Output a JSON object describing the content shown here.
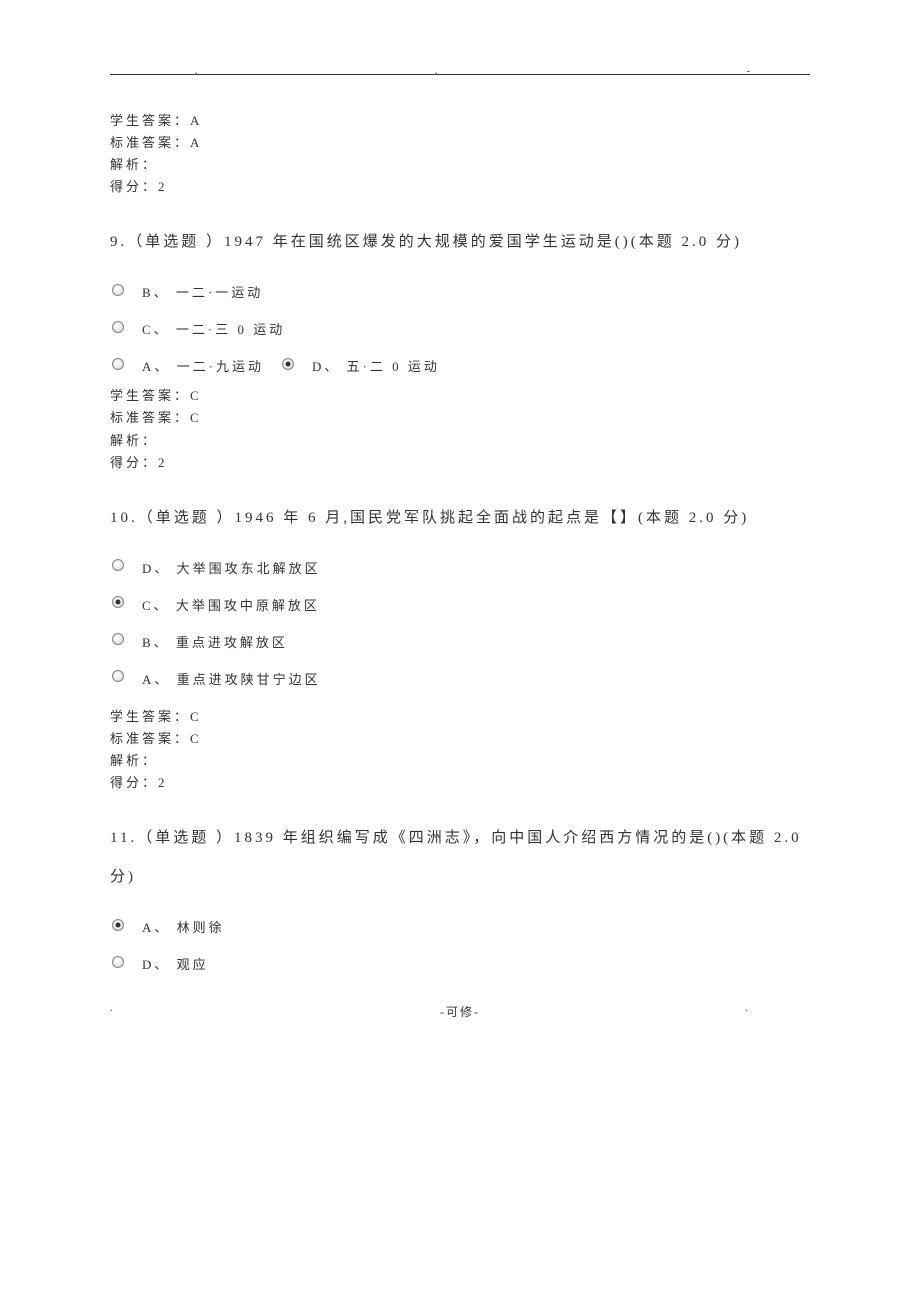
{
  "q8": {
    "student_answer_label": "学生答案：A",
    "standard_answer_label": "标准答案：A",
    "analysis_label": "解析：",
    "score_label": "得分：2"
  },
  "q9": {
    "stem": "9.（单选题 ）1947 年在国统区爆发的大规模的爱国学生运动是()(本题 2.0 分)",
    "options": {
      "b": "B、 一二·一运动",
      "c": "C、 一二·三 0 运动",
      "a": "A、 一二·九运动",
      "d": "D、 五·二 0 运动"
    },
    "student_answer_label": "学生答案：C",
    "standard_answer_label": "标准答案：C",
    "analysis_label": "解析：",
    "score_label": "得分：2"
  },
  "q10": {
    "stem": "10.（单选题 ）1946 年 6 月,国民党军队挑起全面战的起点是【】(本题 2.0 分)",
    "options": {
      "d": "D、 大举围攻东北解放区",
      "c": "C、 大举围攻中原解放区",
      "b": "B、 重点进攻解放区",
      "a": "A、 重点进攻陕甘宁边区"
    },
    "student_answer_label": "学生答案：C",
    "standard_answer_label": "标准答案：C",
    "analysis_label": "解析：",
    "score_label": "得分：2"
  },
  "q11": {
    "stem": "11.（单选题 ）1839 年组织编写成《四洲志》，向中国人介绍西方情况的是()(本题 2.0 分)",
    "options": {
      "a": "A、 林则徐",
      "d": "D、 观应"
    }
  },
  "footer_text": "-可修-"
}
